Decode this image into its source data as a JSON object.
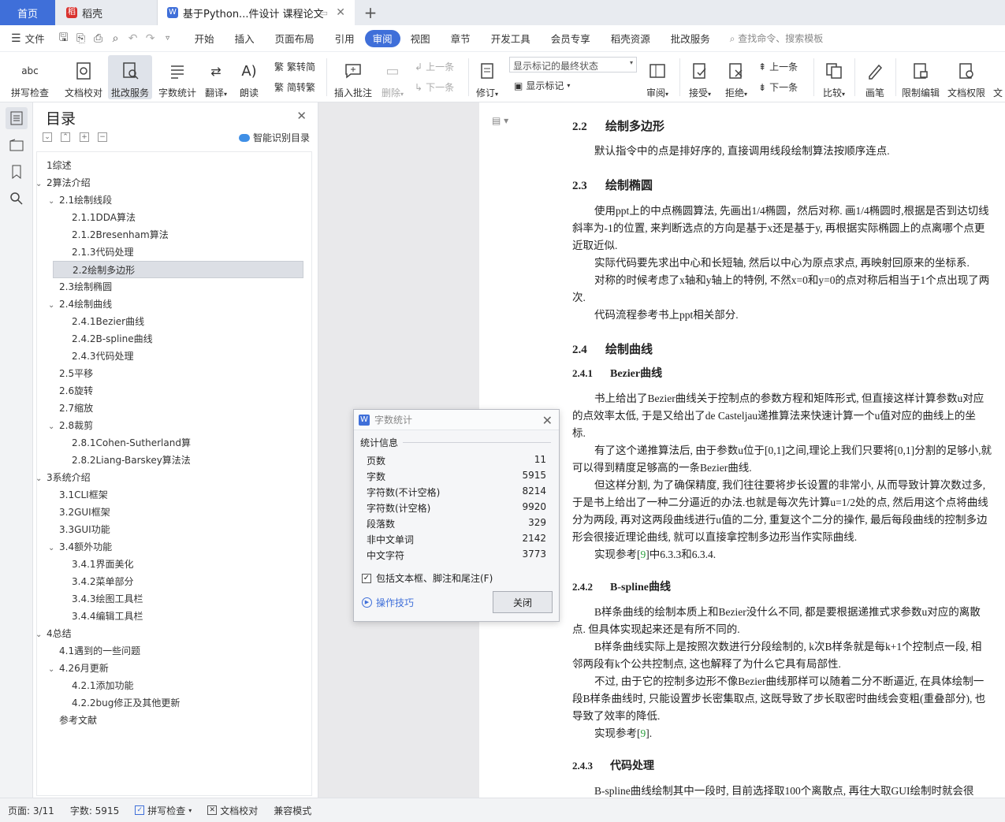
{
  "tabs": {
    "home": "首页",
    "daoke": "稻壳",
    "doc": "基于Python...件设计 课程论文"
  },
  "menu": {
    "file": "文件",
    "items": [
      "开始",
      "插入",
      "页面布局",
      "引用",
      "审阅",
      "视图",
      "章节",
      "开发工具",
      "会员专享",
      "稻壳资源",
      "批改服务"
    ],
    "active": "审阅",
    "search": "查找命令、搜索模板"
  },
  "ribbon": {
    "spell": "拼写检查",
    "proof": "文档校对",
    "correct": "批改服务",
    "wordcount": "字数统计",
    "translate": "翻译",
    "read": "朗读",
    "trad": "繁转简",
    "simp": "简转繁",
    "insert_comment": "插入批注",
    "delete": "删除",
    "prev_c": "上一条",
    "next_c": "下一条",
    "revise": "修订",
    "markup_select": "显示标记的最终状态",
    "show_markup": "显示标记",
    "review": "审阅",
    "accept": "接受",
    "reject": "拒绝",
    "prev": "上一条",
    "next": "下一条",
    "compare": "比较",
    "pen": "画笔",
    "restrict": "限制编辑",
    "doc_rights": "文档权限",
    "more": "文"
  },
  "toc": {
    "title": "目录",
    "smart": "智能识别目录",
    "items": [
      "1综述",
      "2算法介绍",
      "2.1绘制线段",
      "2.1.1DDA算法",
      "2.1.2Bresenham算法",
      "2.1.3代码处理",
      "2.2绘制多边形",
      "2.3绘制椭圆",
      "2.4绘制曲线",
      "2.4.1Bezier曲线",
      "2.4.2B-spline曲线",
      "2.4.3代码处理",
      "2.5平移",
      "2.6旋转",
      "2.7缩放",
      "2.8裁剪",
      "2.8.1Cohen-Sutherland算",
      "2.8.2Liang-Barskey算法法",
      "3系统介绍",
      "3.1CLI框架",
      "3.2GUI框架",
      "3.3GUI功能",
      "3.4额外功能",
      "3.4.1界面美化",
      "3.4.2菜单部分",
      "3.4.3绘图工具栏",
      "3.4.4编辑工具栏",
      "4总结",
      "4.1遇到的一些问题",
      "4.26月更新",
      "4.2.1添加功能",
      "4.2.2bug修正及其他更新",
      "参考文献"
    ],
    "selected": "2.2绘制多边形"
  },
  "doc": {
    "h22_num": "2.2",
    "h22": "绘制多边形",
    "p22": "默认指令中的点是排好序的, 直接调用线段绘制算法按顺序连点.",
    "h23_num": "2.3",
    "h23": "绘制椭圆",
    "p23a1": "使用ppt上的中点椭圆算法, 先画出1/4椭圆，然后对称. 画1/4椭圆时,根据是否到达切线",
    "p23a2": "斜率为-1的位置, 来判断选点的方向是基于x还是基于y, 再根据实际椭圆上的点离哪个点更",
    "p23a3": "近取近似.",
    "p23b": "实际代码要先求出中心和长短轴, 然后以中心为原点求点, 再映射回原来的坐标系.",
    "p23c1": "对称的时候考虑了x轴和y轴上的特例, 不然x=0和y=0的点对称后相当于1个点出现了两",
    "p23c2": "次.",
    "p23d": "代码流程参考书上ppt相关部分.",
    "h24_num": "2.4",
    "h24": "绘制曲线",
    "h241_num": "2.4.1",
    "h241": "Bezier曲线",
    "p241a1": "书上给出了Bezier曲线关于控制点的参数方程和矩阵形式, 但直接这样计算参数u对应",
    "p241a2": "的点效率太低, 于是又给出了de Casteljau递推算法来快速计算一个u值对应的曲线上的坐",
    "p241a3": "标.",
    "p241b1": "有了这个递推算法后, 由于参数u位于[0,1]之间,理论上我们只要将[0,1]分割的足够小,就",
    "p241b2": "可以得到精度足够高的一条Bezier曲线.",
    "p241c1": "但这样分割, 为了确保精度, 我们往往要将步长设置的非常小, 从而导致计算次数过多,",
    "p241c2": "于是书上给出了一种二分逼近的办法.也就是每次先计算u=1/2处的点, 然后用这个点将曲线",
    "p241c3": "分为两段, 再对这两段曲线进行u值的二分, 重复这个二分的操作, 最后每段曲线的控制多边",
    "p241c4": "形会很接近理论曲线, 就可以直接拿控制多边形当作实际曲线.",
    "p241d_pre": "实现参考[",
    "p241d_ref": "9",
    "p241d_post": "]中6.3.3和6.3.4.",
    "h242_num": "2.4.2",
    "h242": "B-spline曲线",
    "p242a1": "B样条曲线的绘制本质上和Bezier没什么不同, 都是要根据递推式求参数u对应的离散",
    "p242a2": "点. 但具体实现起来还是有所不同的.",
    "p242b1": "B样条曲线实际上是按照次数进行分段绘制的, k次B样条就是每k+1个控制点一段, 相",
    "p242b2": "邻两段有k个公共控制点, 这也解释了为什么它具有局部性.",
    "p242c1": "不过, 由于它的控制多边形不像Bezier曲线那样可以随着二分不断逼近, 在具体绘制一",
    "p242c2": "段B样条曲线时, 只能设置步长密集取点, 这既导致了步长取密时曲线会变粗(重叠部分), 也",
    "p242c3": "导致了效率的降低.",
    "p242d_pre": "实现参考[",
    "p242d_ref": "9",
    "p242d_post": "].",
    "h243_num": "2.4.3",
    "h243": "代码处理",
    "p243": "B-spline曲线绘制其中一段时, 目前选择取100个离散点, 再往大取GUI绘制时就会很"
  },
  "dialog": {
    "title": "字数统计",
    "section": "统计信息",
    "rows": [
      [
        "页数",
        "11"
      ],
      [
        "字数",
        "5915"
      ],
      [
        "字符数(不计空格)",
        "8214"
      ],
      [
        "字符数(计空格)",
        "9920"
      ],
      [
        "段落数",
        "329"
      ],
      [
        "非中文单词",
        "2142"
      ],
      [
        "中文字符",
        "3773"
      ]
    ],
    "checkbox": "包括文本框、脚注和尾注(F)",
    "tips": "操作技巧",
    "close": "关闭"
  },
  "status": {
    "page": "页面: 3/11",
    "words": "字数: 5915",
    "spell": "拼写检查",
    "proof": "文档校对",
    "compat": "兼容模式"
  },
  "colors": {
    "accent": "#3f6fd9",
    "ref": "#2a9d3c"
  }
}
